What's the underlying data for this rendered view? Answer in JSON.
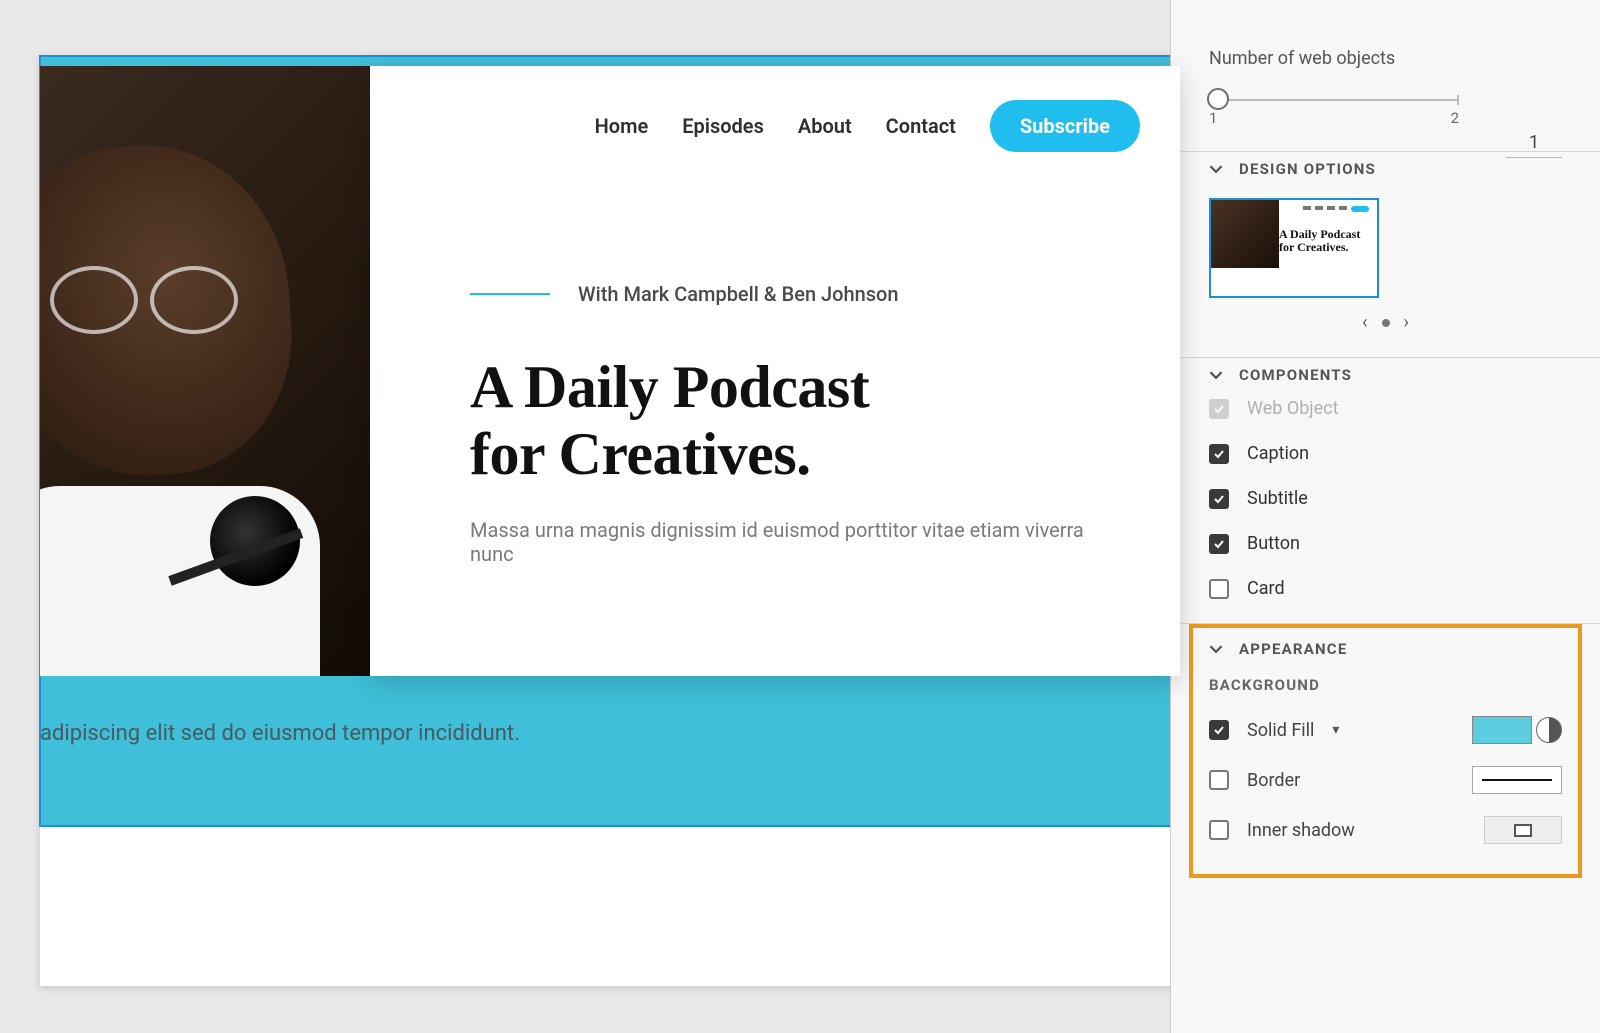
{
  "canvas": {
    "nav": {
      "items": [
        "Home",
        "Episodes",
        "About",
        "Contact"
      ],
      "subscribe_label": "Subscribe"
    },
    "hero": {
      "subline": "With Mark Campbell & Ben Johnson",
      "title_l1": "A Daily Podcast",
      "title_l2": "for Creatives.",
      "desc": "Massa urna magnis dignissim id euismod porttitor vitae etiam viverra nunc"
    },
    "bg_caption": "adipiscing elit sed do eiusmod tempor incididunt."
  },
  "panel": {
    "web_objects": {
      "label": "Number of web objects",
      "min": "1",
      "max": "2",
      "value": "1"
    },
    "design_options": {
      "header": "DESIGN OPTIONS",
      "thumb_title_l1": "A Daily Podcast",
      "thumb_title_l2": "for Creatives."
    },
    "components": {
      "header": "COMPONENTS",
      "items": [
        {
          "label": "Web Object",
          "checked": true,
          "disabled": true
        },
        {
          "label": "Caption",
          "checked": true,
          "disabled": false
        },
        {
          "label": "Subtitle",
          "checked": true,
          "disabled": false
        },
        {
          "label": "Button",
          "checked": true,
          "disabled": false
        },
        {
          "label": "Card",
          "checked": false,
          "disabled": false
        }
      ]
    },
    "appearance": {
      "header": "APPEARANCE",
      "background_header": "BACKGROUND",
      "solid_fill": {
        "label": "Solid Fill",
        "checked": true,
        "color": "#5fcde0"
      },
      "border": {
        "label": "Border",
        "checked": false
      },
      "inner_shadow": {
        "label": "Inner shadow",
        "checked": false
      }
    }
  }
}
